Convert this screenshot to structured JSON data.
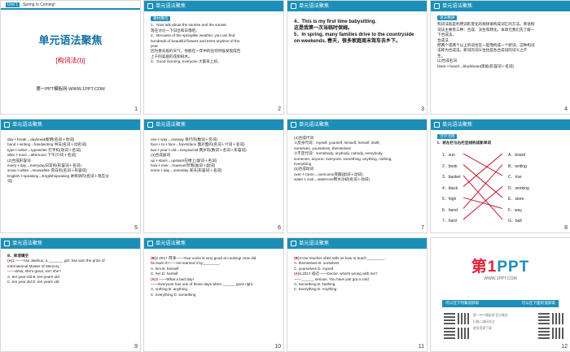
{
  "header_title": "单元语法聚焦",
  "slide1": {
    "unit": "Unit 1",
    "subtitle": "Spring Is Coming!",
    "title": "单元语法聚焦",
    "topic": "[构词法(Ⅰ)]",
    "footer": "第一PPT模板网-WWW.1PPT.COM"
  },
  "slide2": {
    "tag": "教材典句",
    "lines": [
      "1．Now talk about the sunrise and the sunset.",
      "现在讨论一下日出和日落吧。",
      "2．Because of the springlike weather, you can find",
      "hundreds of beautiful flowers and trees anytime of the",
      "year.",
      "因为春天般的天气，你能在一年中的任何时候发现成百",
      "上千的美丽的花和树木。",
      "3．Good morning, everyone 大家早上好。"
    ]
  },
  "slide3": {
    "lines": [
      "4．This is my first time babysitting.",
      "这是我第一次当临时保姆。",
      "5．In spring, many families drive to the countryside",
      "on weekends. 春天，很多家庭周末驾车去乡下。"
    ]
  },
  "slide4": {
    "tag": "语法精讲",
    "lines": [
      "构词法就是利用词形变化的规律来构成词汇的方法。英语构",
      "词法主要有三种：合成、派生和转化。本单元我们先了解一",
      "下合成法。",
      "合成法",
      "把两个或两个以上的词合在一起而构成一个新词，这种构词",
      "法称为合成法。新词的词义往往是各合成词的词义之产",
      "生。",
      "(1)合成名词",
      "black＋board→blackboard黑板(形容词＋名词)"
    ]
  },
  "slide5": {
    "lines": [
      "day＋break→daybreak黎明(名词＋动词)",
      "hand＋writing→handwriting 书法(名词＋动名词)",
      "type＋writer→typewriter 打字机(动词＋名词)",
      "after＋noon→afternoon 下午(介词＋名词)",
      "(2)合成形容词",
      "every＋day→everyday日常的(形容词＋名词)",
      "snow＋white→snowwhite 雪白的(名词＋形容词)",
      "English＋speaking→Englishspeaking 讲英语的(名词＋现在分",
      "词)"
    ]
  },
  "slide6": {
    "lines": [
      "one＋way→oneway 单行的(数词＋名词)",
      "face＋to＋face→facetoface 面对面的(名词＋介词＋名词)",
      "two＋year＋old→twoyearold 两岁的(数词＋名词＋形容词)",
      "(3)合成副词",
      "up＋stairs→upstairs在楼上(副词＋名词)",
      "how＋ever→however然而(副词＋副词)",
      "some＋day→someday 某天(形容词＋名词)"
    ]
  },
  "slide7": {
    "lines": [
      "(4)合成代词",
      "①反身代词：myself, yourself, himself, herself, itself,",
      "ourselves, yourselves, themselves",
      "②不定代词：somebody, anybody, nobody, everybody,",
      "someone, anyone, everyone, something, anything, nothing,",
      "everything",
      "(5)合成动词",
      "over＋come→overcome克服(副词＋动词)",
      "water＋cool→watercool用水冷却(名词＋动词)"
    ]
  },
  "slide8": {
    "tag": "活学活用",
    "instruction": "Ⅰ．将左栏与右栏连线构成新单词",
    "left": [
      "1．sun",
      "2．book",
      "3．basket",
      "4．black",
      "5．high",
      "6．hand",
      "7．hard"
    ],
    "right": [
      "A．board",
      "B．writing",
      "C．rise",
      "D．working",
      "E．store",
      "F．way",
      "G．ball"
    ],
    "pairs": [
      [
        0,
        2
      ],
      [
        1,
        4
      ],
      [
        2,
        6
      ],
      [
        3,
        0
      ],
      [
        4,
        5
      ],
      [
        5,
        1
      ],
      [
        6,
        3
      ]
    ]
  },
  "slide9": {
    "heading": "Ⅱ．单项填空",
    "q_answer": "A",
    "lines": [
      ")1.——Yan Jiashuo, a _______ girl, has won the prize  of",
      "International Master  of Memory.",
      "——Wow, she's great, isn't she?",
      "A. ten-year-old          B. ten-years-old",
      "C. ten year old          D. ten years old"
    ]
  },
  "slide10": {
    "q1_answer": "B",
    "q1_lines": [
      ")2.2017·菏泽——Your uncle is very good at cooking! How did",
      "he learn it?——He learned it by________.",
      "A. him                    B. himself",
      "C. her                    D. herself"
    ],
    "q2_answer": "A",
    "q2_lines": [
      ")3.——What a bad day!",
      "——Everyone has one of those days when ______ goes right.",
      "A. nothing               B. anything",
      "C. everything            D. something"
    ]
  },
  "slide11": {
    "q1_answer": "B",
    "q1_lines": [
      ")4.Our teacher often tells us how to teach ________.",
      "A. themselves             B. ourselves",
      "C. yourselves             D. myself"
    ],
    "q2_answer": "A",
    "q2_lines": [
      ")5.2017·宿迁——Doctor, what's wrong with me?",
      "——______ serious. You have just got a cold.",
      "A. Something            B. Nothing",
      "C. Everything           D. Anything"
    ]
  },
  "slide12": {
    "logo_num": "第1",
    "logo_text": "PPT",
    "logo_sub": "WWW.1PPT.COM",
    "bar_left": "可以在下列集道获取",
    "bar_right": "可以在下面的道获取",
    "small_lines": [
      "第一PPT模板网 官方微信",
      "扫描二维码关注",
      "更多资源下载"
    ]
  },
  "page_numbers": [
    "1",
    "2",
    "3",
    "4",
    "5",
    "6",
    "7",
    "8",
    "9",
    "10",
    "11",
    "12"
  ]
}
